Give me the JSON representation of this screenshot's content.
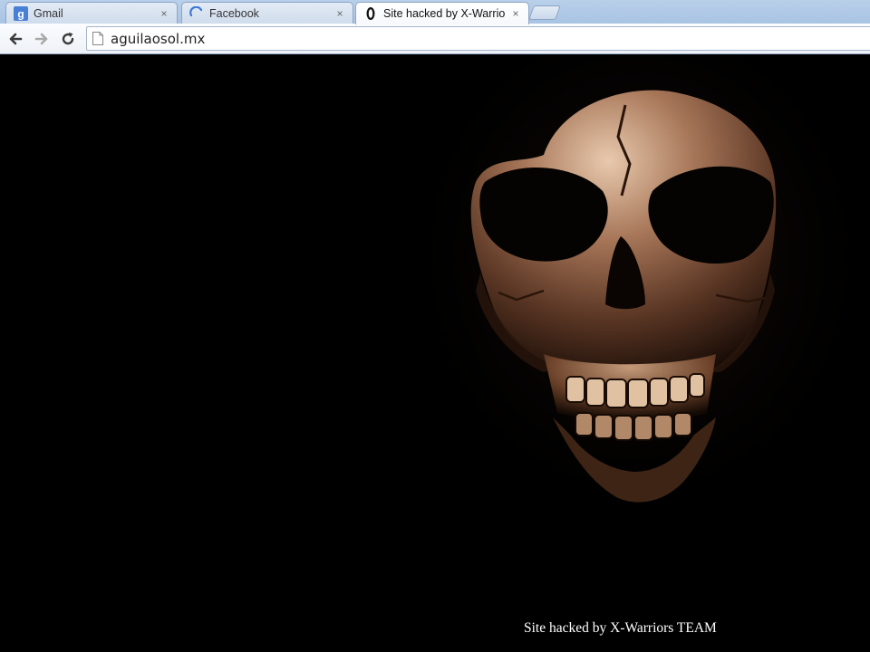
{
  "browser": {
    "tabs": [
      {
        "label": "Gmail",
        "favicon": "google-g-icon",
        "active": false
      },
      {
        "label": "Facebook",
        "favicon": "loading-spinner-icon",
        "active": false
      },
      {
        "label": "Site hacked by X-Warriors",
        "favicon": "page-globe-icon",
        "active": true
      }
    ],
    "close_glyph": "×",
    "url": "aguilaosol.mx"
  },
  "page": {
    "background_color": "#000000",
    "image": "skull-image",
    "caption": "Site hacked by X-Warriors TEAM"
  }
}
